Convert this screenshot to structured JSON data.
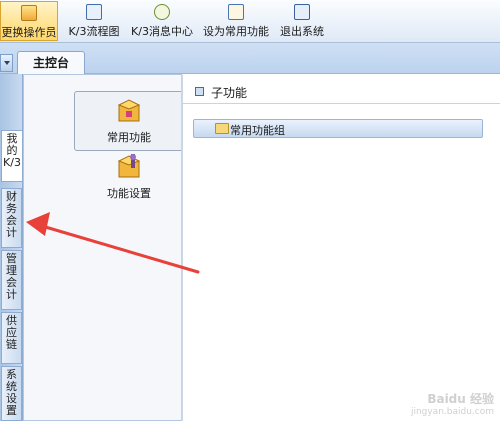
{
  "toolbar": {
    "buttons": [
      {
        "label": "更换操作员",
        "icon": "user-switch-icon"
      },
      {
        "label": "K/3流程图",
        "icon": "flowchart-icon"
      },
      {
        "label": "K/3消息中心",
        "icon": "message-center-icon"
      },
      {
        "label": "设为常用功能",
        "icon": "favorite-set-icon"
      },
      {
        "label": "退出系统",
        "icon": "exit-icon"
      }
    ]
  },
  "tabs": {
    "main_tab": "主控台"
  },
  "side_tabs": [
    {
      "label": "我的K/3",
      "active": true
    },
    {
      "label": "财务会计",
      "active": false
    },
    {
      "label": "管理会计",
      "active": false
    },
    {
      "label": "供应链",
      "active": false
    },
    {
      "label": "系统设置",
      "active": false
    }
  ],
  "functions": [
    {
      "label": "常用功能",
      "icon": "box-icon",
      "selected": true
    },
    {
      "label": "功能设置",
      "icon": "box-settings-icon",
      "selected": false
    }
  ],
  "content": {
    "header": "子功能",
    "group_label": "常用功能组"
  },
  "watermark": {
    "line1": "Baidu 经验",
    "line2": "jingyan.baidu.com"
  },
  "colors": {
    "accent": "#ffd86a",
    "panel_border": "#8eacd2",
    "arrow": "#e8413a"
  }
}
